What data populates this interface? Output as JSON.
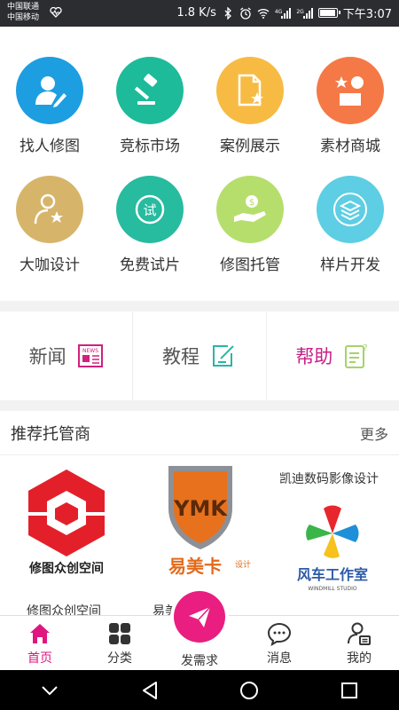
{
  "status_bar": {
    "carrier_1": "中国联通",
    "carrier_2": "中国移动",
    "net_speed": "1.8 K/s",
    "signal_1_tag": "4G",
    "signal_2_tag": "2G",
    "time": "下午3:07",
    "battery_level": 0.85
  },
  "grid": [
    {
      "label": "找人修图",
      "icon": "person-edit-icon",
      "color": "#1d9ee0"
    },
    {
      "label": "竞标市场",
      "icon": "gavel-icon",
      "color": "#1dbb99"
    },
    {
      "label": "案例展示",
      "icon": "document-star-icon",
      "color": "#f7bb44"
    },
    {
      "label": "素材商城",
      "icon": "shapes-icon",
      "color": "#f57946"
    },
    {
      "label": "大咖设计",
      "icon": "person-star-icon",
      "color": "#d6b56b"
    },
    {
      "label": "免费试片",
      "icon": "trial-icon",
      "color": "#27bba0"
    },
    {
      "label": "修图托管",
      "icon": "hand-coin-icon",
      "color": "#b6de6c"
    },
    {
      "label": "样片开发",
      "icon": "layers-icon",
      "color": "#5dcee3"
    }
  ],
  "news_row": [
    {
      "label": "新闻",
      "icon": "news-icon",
      "color": "#555555",
      "icon_color": "#d1207f"
    },
    {
      "label": "教程",
      "icon": "edit-note-icon",
      "color": "#555555",
      "icon_color": "#29b6a6"
    },
    {
      "label": "帮助",
      "icon": "help-doc-icon",
      "color": "#c81f86",
      "icon_color": "#a6d36a"
    }
  ],
  "recommend": {
    "title": "推荐托管商",
    "more": "更多",
    "items": [
      {
        "name": "修图众创空间",
        "logo_text": "修图众创空间"
      },
      {
        "name": "易美卡设计",
        "logo_text": "易美卡",
        "logo_sub": "设计",
        "logo_mark": "YMK"
      },
      {
        "name": "凯迪数码影像设计",
        "logo_text": "风车工作室",
        "logo_sub": "WINDMILL STUDIO"
      }
    ]
  },
  "tabs": [
    {
      "label": "首页",
      "icon": "home-icon",
      "active": true
    },
    {
      "label": "分类",
      "icon": "grid-icon",
      "active": false
    },
    {
      "label": "发需求",
      "icon": "paper-plane-icon",
      "active": false
    },
    {
      "label": "消息",
      "icon": "chat-icon",
      "active": false
    },
    {
      "label": "我的",
      "icon": "profile-icon",
      "active": false
    }
  ],
  "accent_color": "#e91e80"
}
